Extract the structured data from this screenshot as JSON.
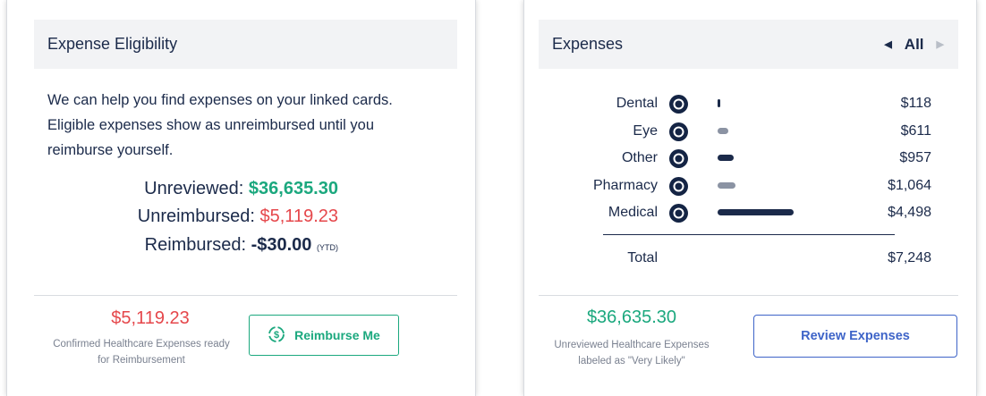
{
  "eligibility": {
    "title": "Expense Eligibility",
    "intro": "We can help you find expenses on your linked cards. Eligible expenses show as unreimbursed until you reimburse yourself.",
    "unreviewed_label": "Unreviewed:",
    "unreviewed_value": "$36,635.30",
    "unreimbursed_label": "Unreimbursed:",
    "unreimbursed_value": "$5,119.23",
    "reimbursed_label": "Reimbursed:",
    "reimbursed_value": "-$30.00",
    "reimbursed_suffix": "(YTD)",
    "footer_amount": "$5,119.23",
    "footer_caption_1": "Confirmed Healthcare Expenses ready",
    "footer_caption_2": "for Reimbursement",
    "button_label": "Reimburse Me"
  },
  "expenses": {
    "title": "Expenses",
    "filter_value": "All",
    "categories": [
      {
        "name": "Dental",
        "icon": "tooth-icon",
        "amount": "$118",
        "value": 118
      },
      {
        "name": "Eye",
        "icon": "glasses-icon",
        "amount": "$611",
        "value": 611
      },
      {
        "name": "Other",
        "icon": "medical-kit-icon",
        "amount": "$957",
        "value": 957
      },
      {
        "name": "Pharmacy",
        "icon": "pill-icon",
        "amount": "$1,064",
        "value": 1064
      },
      {
        "name": "Medical",
        "icon": "stethoscope-icon",
        "amount": "$4,498",
        "value": 4498
      }
    ],
    "bar_colors": [
      "#1b2a4a",
      "#8b93a3",
      "#1b2a4a",
      "#8b93a3",
      "#1b2a4a"
    ],
    "total_label": "Total",
    "total_amount": "$7,248",
    "footer_amount": "$36,635.30",
    "footer_caption_1": "Unreviewed Healthcare Expenses",
    "footer_caption_2": "labeled as \"Very Likely\"",
    "button_label": "Review Expenses"
  },
  "colors": {
    "green": "#1ba87e",
    "red": "#e5474b",
    "navy": "#1b2a4a",
    "blue": "#3e64c8"
  }
}
